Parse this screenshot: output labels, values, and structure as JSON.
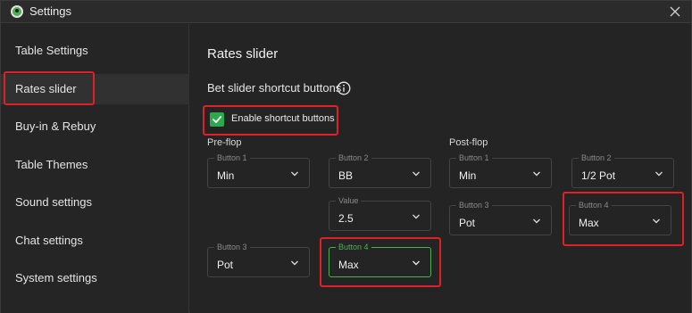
{
  "window": {
    "title": "Settings"
  },
  "sidebar": {
    "items": [
      {
        "label": "Table Settings"
      },
      {
        "label": "Rates slider"
      },
      {
        "label": "Buy-in & Rebuy"
      },
      {
        "label": "Table Themes"
      },
      {
        "label": "Sound settings"
      },
      {
        "label": "Chat settings"
      },
      {
        "label": "System settings"
      }
    ],
    "active_index": 1
  },
  "main": {
    "title": "Rates slider",
    "subheading": "Bet slider shortcut buttons",
    "enable_checkbox": {
      "label": "Enable shortcut buttons",
      "checked": true
    },
    "preflop": {
      "label": "Pre-flop",
      "button1": {
        "legend": "Button 1",
        "value": "Min"
      },
      "button2": {
        "legend": "Button 2",
        "value": "BB"
      },
      "value": {
        "legend": "Value",
        "value": "2.5"
      },
      "button3": {
        "legend": "Button 3",
        "value": "Pot"
      },
      "button4": {
        "legend": "Button 4",
        "value": "Max"
      }
    },
    "postflop": {
      "label": "Post-flop",
      "button1": {
        "legend": "Button 1",
        "value": "Min"
      },
      "button2": {
        "legend": "Button 2",
        "value": "1/2 Pot"
      },
      "button3": {
        "legend": "Button 3",
        "value": "Pot"
      },
      "button4": {
        "legend": "Button 4",
        "value": "Max"
      }
    }
  },
  "colors": {
    "accent_green": "#4caf50",
    "checkbox_green": "#2ea84c",
    "highlight_red": "#e01f26",
    "background": "#242424"
  }
}
